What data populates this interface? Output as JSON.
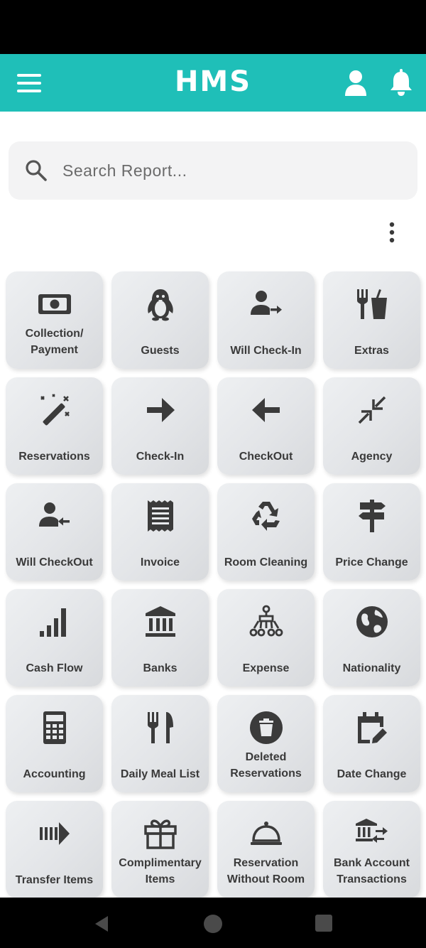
{
  "app": {
    "title": "HMS"
  },
  "colors": {
    "accent": "#1fbfb8",
    "tile_text": "#3a3a3a",
    "icon": "#3b3b3b"
  },
  "search": {
    "placeholder": "Search Report..."
  },
  "tiles": [
    {
      "label": "Collection/\nPayment",
      "icon": "money-bill-icon"
    },
    {
      "label": "Guests",
      "icon": "penguin-icon"
    },
    {
      "label": "Will Check-In",
      "icon": "user-arrow-right-icon"
    },
    {
      "label": "Extras",
      "icon": "utensils-drink-icon"
    },
    {
      "label": "Reservations",
      "icon": "magic-wand-icon"
    },
    {
      "label": "Check-In",
      "icon": "arrow-right-icon"
    },
    {
      "label": "CheckOut",
      "icon": "arrow-left-icon"
    },
    {
      "label": "Agency",
      "icon": "compress-arrows-icon"
    },
    {
      "label": "Will CheckOut",
      "icon": "user-arrow-left-icon"
    },
    {
      "label": "Invoice",
      "icon": "receipt-icon"
    },
    {
      "label": "Room Cleaning",
      "icon": "recycle-icon"
    },
    {
      "label": "Price Change",
      "icon": "signpost-icon"
    },
    {
      "label": "Cash Flow",
      "icon": "signal-bars-icon"
    },
    {
      "label": "Banks",
      "icon": "bank-icon"
    },
    {
      "label": "Expense",
      "icon": "sitemap-icon"
    },
    {
      "label": "Nationality",
      "icon": "globe-icon"
    },
    {
      "label": "Accounting",
      "icon": "calculator-icon"
    },
    {
      "label": "Daily Meal List",
      "icon": "utensils-icon"
    },
    {
      "label": "Deleted\nReservations",
      "icon": "trash-circle-icon"
    },
    {
      "label": "Date Change",
      "icon": "calendar-edit-icon"
    },
    {
      "label": "Transfer Items",
      "icon": "transfer-arrow-icon"
    },
    {
      "label": "Complimentary\nItems",
      "icon": "gift-icon"
    },
    {
      "label": "Reservation\nWithout Room",
      "icon": "cloche-icon"
    },
    {
      "label": "Bank Account\nTransactions",
      "icon": "bank-transfer-icon"
    }
  ]
}
